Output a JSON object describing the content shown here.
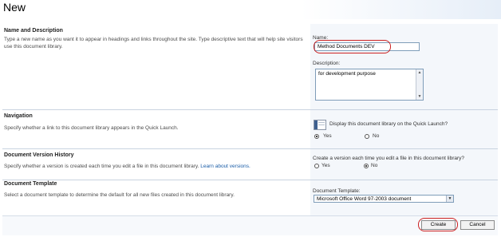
{
  "page": {
    "title": "New"
  },
  "sections": {
    "name_desc": {
      "heading": "Name and Description",
      "desc": "Type a new name as you want it to appear in headings and links throughout the site. Type descriptive text that will help site visitors use this document library.",
      "name_label": "Name:",
      "name_value": "Method Documents DEV",
      "description_label": "Description:",
      "description_value": "for development purpose"
    },
    "navigation": {
      "heading": "Navigation",
      "desc": "Specify whether a link to this document library appears in the Quick Launch.",
      "question": "Display this document library on the Quick Launch?",
      "yes": "Yes",
      "no": "No",
      "selected": "Yes"
    },
    "versioning": {
      "heading": "Document Version History",
      "desc": "Specify whether a version is created each time you edit a file in this document library.",
      "link": "Learn about versions.",
      "question": "Create a version each time you edit a file in this document library?",
      "yes": "Yes",
      "no": "No",
      "selected": "No"
    },
    "template": {
      "heading": "Document Template",
      "desc": "Select a document template to determine the default for all new files created in this document library.",
      "label": "Document Template:",
      "value": "Microsoft Office Word 97-2003 document"
    }
  },
  "buttons": {
    "create": "Create",
    "cancel": "Cancel"
  },
  "icons": {
    "quick_launch": "quick-launch-preview-icon",
    "dropdown": "chevron-down-icon"
  },
  "colors": {
    "highlight": "#cc2222",
    "link": "#1c5ea8",
    "input_border": "#7f9db9"
  }
}
